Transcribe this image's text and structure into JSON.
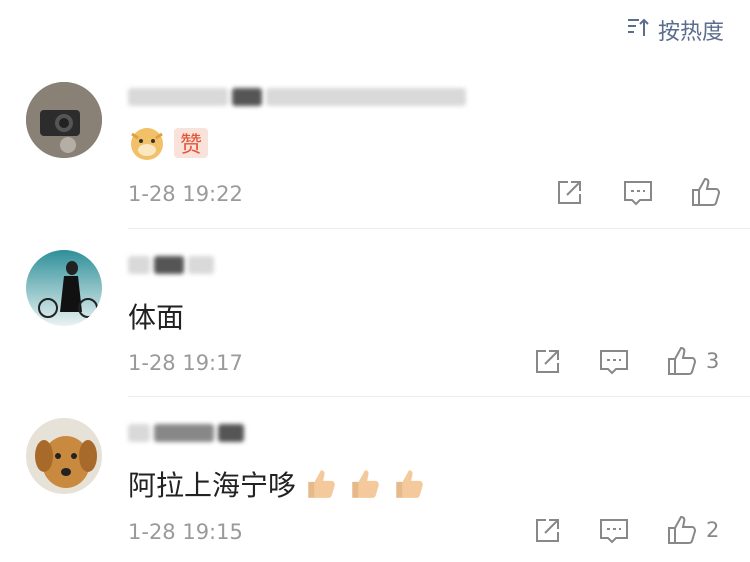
{
  "header": {
    "sort_label": "按热度"
  },
  "comments": [
    {
      "text": "",
      "time": "1-28 19:22",
      "likes": ""
    },
    {
      "text": "体面",
      "time": "1-28 19:17",
      "likes": "3"
    },
    {
      "text": "阿拉上海宁哆",
      "time": "1-28 19:15",
      "likes": "2"
    }
  ],
  "icons": {
    "sort": "sort-icon",
    "share": "share-icon",
    "comment": "comment-icon",
    "like": "thumbs-up-icon"
  },
  "colors": {
    "accent": "#5b6d8c",
    "time": "#9a9a9a"
  }
}
